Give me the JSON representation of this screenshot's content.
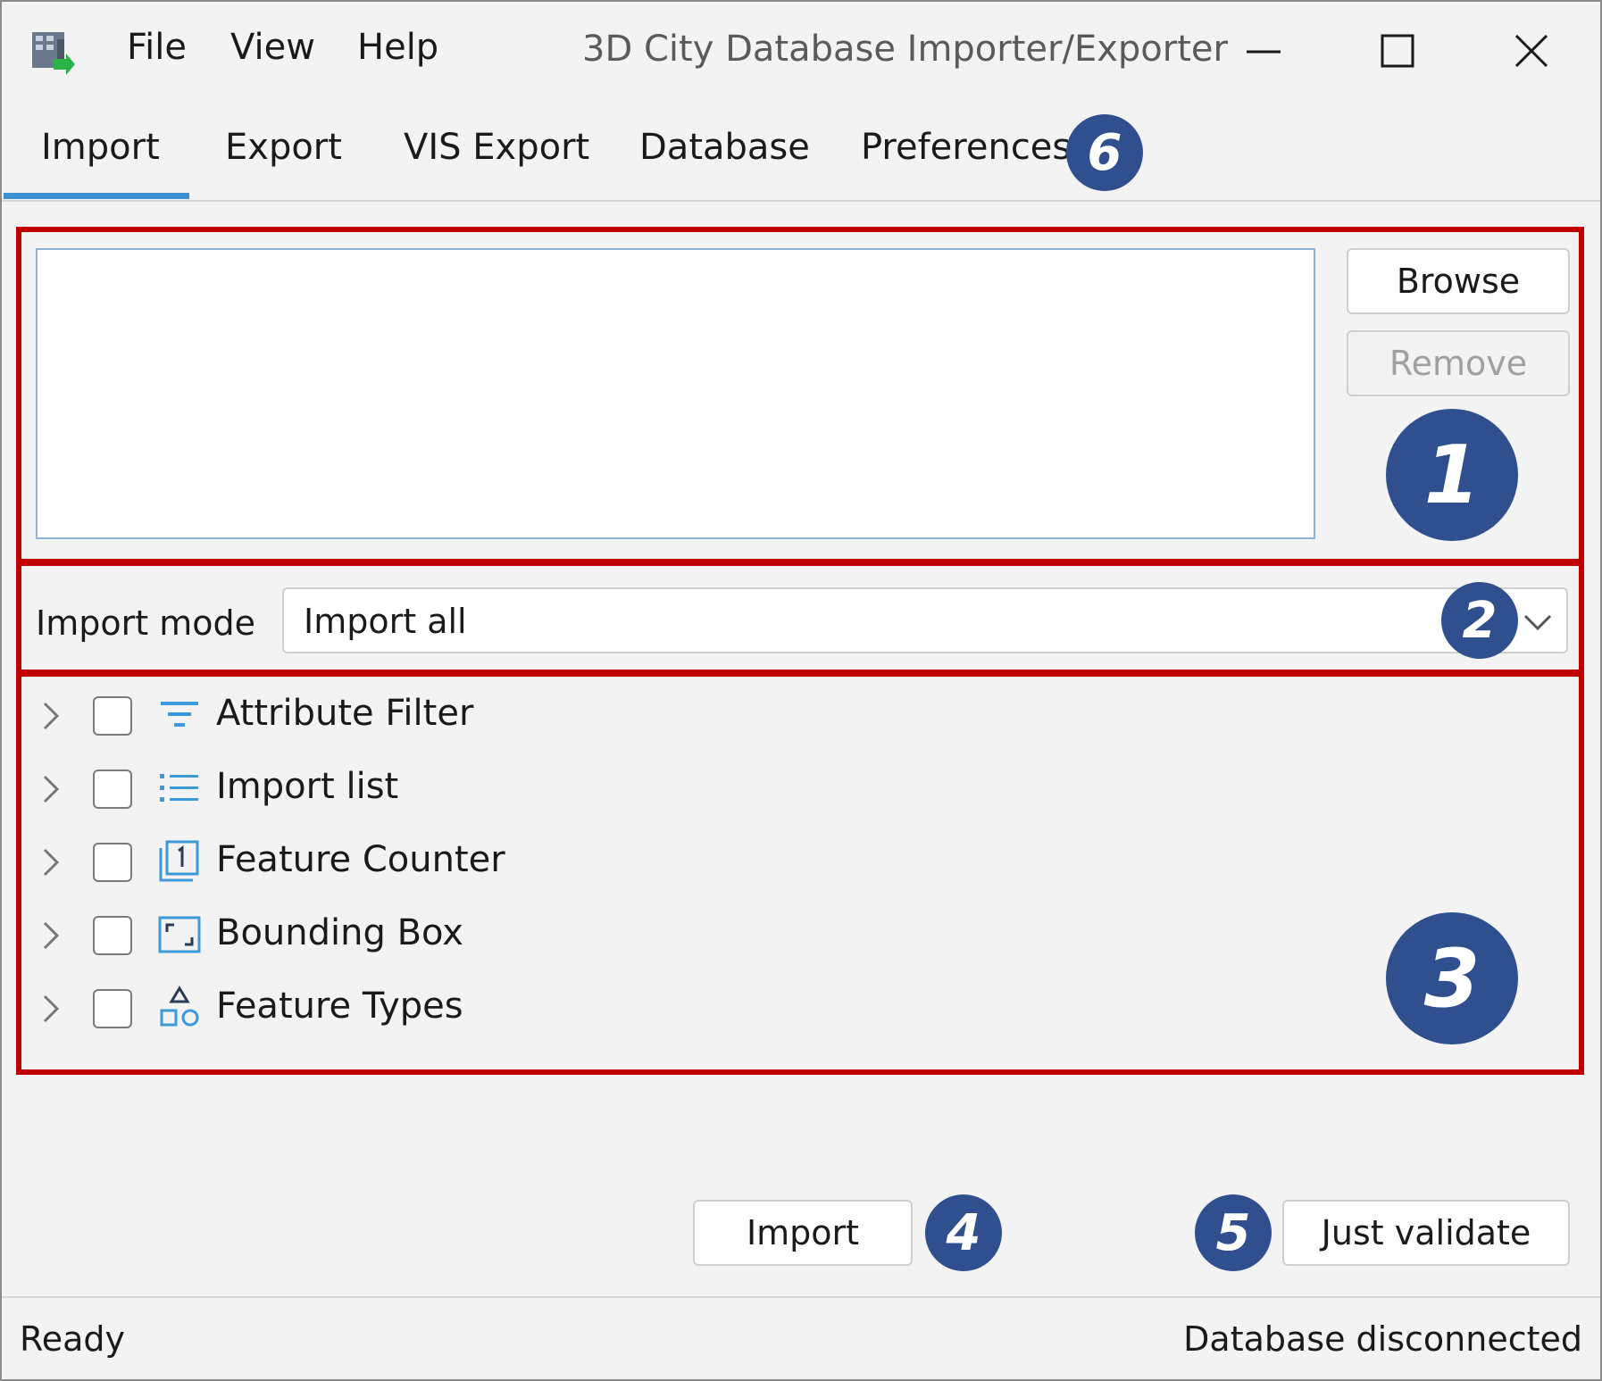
{
  "window": {
    "title": "3D City Database Importer/Exporter",
    "menu": [
      "File",
      "View",
      "Help"
    ]
  },
  "tabs": [
    "Import",
    "Export",
    "VIS Export",
    "Database",
    "Preferences"
  ],
  "active_tab": "Import",
  "file_panel": {
    "browse_label": "Browse",
    "remove_label": "Remove"
  },
  "import_mode": {
    "label": "Import mode",
    "selected": "Import all"
  },
  "filters": [
    {
      "label": "Attribute Filter",
      "icon": "filter-icon",
      "checked": false
    },
    {
      "label": "Import list",
      "icon": "list-icon",
      "checked": false
    },
    {
      "label": "Feature Counter",
      "icon": "counter-icon",
      "checked": false
    },
    {
      "label": "Bounding Box",
      "icon": "bounding-box-icon",
      "checked": false
    },
    {
      "label": "Feature Types",
      "icon": "shapes-icon",
      "checked": false
    }
  ],
  "actions": {
    "import_label": "Import",
    "validate_label": "Just validate"
  },
  "status": {
    "left": "Ready",
    "right": "Database disconnected"
  },
  "callouts": [
    "1",
    "2",
    "3",
    "4",
    "5",
    "6"
  ],
  "colors": {
    "callout": "#2f4f8f",
    "highlight": "#c00000",
    "accent": "#3b8fd4",
    "icon_blue": "#3b9ad9"
  }
}
